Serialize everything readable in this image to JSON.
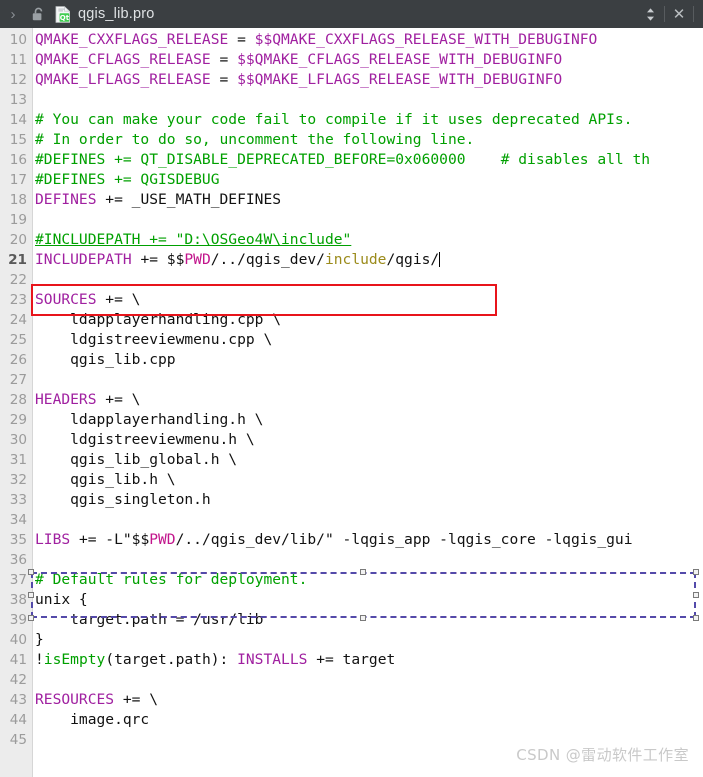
{
  "titlebar": {
    "chevron_glyph": "›",
    "filename": "qgis_lib.pro",
    "lock_icon_name": "open-padlock-icon",
    "file_icon_name": "qt-project-file-icon",
    "nav_icon_name": "split-arrows-icon",
    "close_label": "✕",
    "background_color": "#3b3f42",
    "title_color": "#dfe2e4"
  },
  "editor": {
    "gutter_color": "#ececec",
    "background_color": "#ffffff",
    "first_visible_line": 10,
    "last_visible_line": 45,
    "current_line": 21,
    "colors": {
      "keyword": "#a020a0",
      "comment": "#00a000",
      "variable": "#c2158c",
      "plain": "#111111",
      "include_path": "#9b8b1b",
      "line_number": "#9b9b9b",
      "highlight_box": "#e8141b",
      "selection_box": "#3a54c4"
    },
    "lines": [
      {
        "n": 10,
        "tokens": [
          {
            "t": "QMAKE_CXXFLAGS_RELEASE",
            "c": "kw"
          },
          {
            "t": " = ",
            "c": "pl"
          },
          {
            "t": "$$QMAKE_CXXFLAGS_RELEASE_WITH_DEBUGINFO",
            "c": "kw"
          }
        ]
      },
      {
        "n": 11,
        "tokens": [
          {
            "t": "QMAKE_CFLAGS_RELEASE",
            "c": "kw"
          },
          {
            "t": " = ",
            "c": "pl"
          },
          {
            "t": "$$QMAKE_CFLAGS_RELEASE_WITH_DEBUGINFO",
            "c": "kw"
          }
        ]
      },
      {
        "n": 12,
        "tokens": [
          {
            "t": "QMAKE_LFLAGS_RELEASE",
            "c": "kw"
          },
          {
            "t": " = ",
            "c": "pl"
          },
          {
            "t": "$$QMAKE_LFLAGS_RELEASE_WITH_DEBUGINFO",
            "c": "kw"
          }
        ]
      },
      {
        "n": 13,
        "tokens": []
      },
      {
        "n": 14,
        "tokens": [
          {
            "t": "# You can make your code fail to compile if it uses deprecated APIs.",
            "c": "cm"
          }
        ]
      },
      {
        "n": 15,
        "tokens": [
          {
            "t": "# In order to do so, uncomment the following line.",
            "c": "cm"
          }
        ]
      },
      {
        "n": 16,
        "tokens": [
          {
            "t": "#DEFINES += QT_DISABLE_DEPRECATED_BEFORE=0x060000",
            "c": "cm"
          },
          {
            "t": "    ",
            "c": "pl"
          },
          {
            "t": "# disables all th",
            "c": "cm"
          }
        ]
      },
      {
        "n": 17,
        "tokens": [
          {
            "t": "#DEFINES += QGISDEBUG",
            "c": "cm"
          }
        ]
      },
      {
        "n": 18,
        "tokens": [
          {
            "t": "DEFINES",
            "c": "kw"
          },
          {
            "t": " += _USE_MATH_DEFINES",
            "c": "pl"
          }
        ]
      },
      {
        "n": 19,
        "tokens": []
      },
      {
        "n": 20,
        "tokens": [
          {
            "t": "#INCLUDEPATH += \"D:\\OSGeo4W\\include\"",
            "c": "cmu"
          }
        ]
      },
      {
        "n": 21,
        "tokens": [
          {
            "t": "INCLUDEPATH",
            "c": "kw"
          },
          {
            "t": " += $$",
            "c": "pl"
          },
          {
            "t": "PWD",
            "c": "var"
          },
          {
            "t": "/../qgis_dev/",
            "c": "pl"
          },
          {
            "t": "include",
            "c": "incl"
          },
          {
            "t": "/qgis/",
            "c": "pl"
          }
        ],
        "caret": true
      },
      {
        "n": 22,
        "tokens": []
      },
      {
        "n": 23,
        "tokens": [
          {
            "t": "SOURCES",
            "c": "kw"
          },
          {
            "t": " += \\",
            "c": "pl"
          }
        ]
      },
      {
        "n": 24,
        "tokens": [
          {
            "t": "    ldapplayerhandling.cpp \\",
            "c": "pl"
          }
        ]
      },
      {
        "n": 25,
        "tokens": [
          {
            "t": "    ldgistreeviewmenu.cpp \\",
            "c": "pl"
          }
        ]
      },
      {
        "n": 26,
        "tokens": [
          {
            "t": "    qgis_lib.cpp",
            "c": "pl"
          }
        ]
      },
      {
        "n": 27,
        "tokens": []
      },
      {
        "n": 28,
        "tokens": [
          {
            "t": "HEADERS",
            "c": "kw"
          },
          {
            "t": " += \\",
            "c": "pl"
          }
        ]
      },
      {
        "n": 29,
        "tokens": [
          {
            "t": "    ldapplayerhandling.h \\",
            "c": "pl"
          }
        ]
      },
      {
        "n": 30,
        "tokens": [
          {
            "t": "    ldgistreeviewmenu.h \\",
            "c": "pl"
          }
        ]
      },
      {
        "n": 31,
        "tokens": [
          {
            "t": "    qgis_lib_global.h \\",
            "c": "pl"
          }
        ]
      },
      {
        "n": 32,
        "tokens": [
          {
            "t": "    qgis_lib.h \\",
            "c": "pl"
          }
        ]
      },
      {
        "n": 33,
        "tokens": [
          {
            "t": "    qgis_singleton.h",
            "c": "pl"
          }
        ]
      },
      {
        "n": 34,
        "tokens": []
      },
      {
        "n": 35,
        "tokens": [
          {
            "t": "LIBS",
            "c": "kw"
          },
          {
            "t": " += -L\"$$",
            "c": "pl"
          },
          {
            "t": "PWD",
            "c": "var"
          },
          {
            "t": "/../qgis_dev/lib/\" -lqgis_app -lqgis_core -lqgis_gui",
            "c": "pl"
          }
        ]
      },
      {
        "n": 36,
        "tokens": []
      },
      {
        "n": 37,
        "tokens": [
          {
            "t": "# Default rules for deployment.",
            "c": "cm"
          }
        ]
      },
      {
        "n": 38,
        "tokens": [
          {
            "t": "unix {",
            "c": "pl"
          }
        ]
      },
      {
        "n": 39,
        "tokens": [
          {
            "t": "    target.path = /usr/lib",
            "c": "pl"
          }
        ]
      },
      {
        "n": 40,
        "tokens": [
          {
            "t": "}",
            "c": "pl"
          }
        ]
      },
      {
        "n": 41,
        "tokens": [
          {
            "t": "!",
            "c": "pl"
          },
          {
            "t": "isEmpty",
            "c": "fn"
          },
          {
            "t": "(target.path): ",
            "c": "pl"
          },
          {
            "t": "INSTALLS",
            "c": "kw"
          },
          {
            "t": " += target",
            "c": "pl"
          }
        ]
      },
      {
        "n": 42,
        "tokens": []
      },
      {
        "n": 43,
        "tokens": [
          {
            "t": "RESOURCES",
            "c": "kw"
          },
          {
            "t": " += \\",
            "c": "pl"
          }
        ]
      },
      {
        "n": 44,
        "tokens": [
          {
            "t": "    image.qrc",
            "c": "pl"
          }
        ]
      },
      {
        "n": 45,
        "tokens": []
      }
    ]
  },
  "annotations": {
    "includepath_box_name": "includepath-highlight-box",
    "libs_box_name": "libs-selection-box"
  },
  "watermark": {
    "text": "CSDN @雷动软件工作室"
  }
}
